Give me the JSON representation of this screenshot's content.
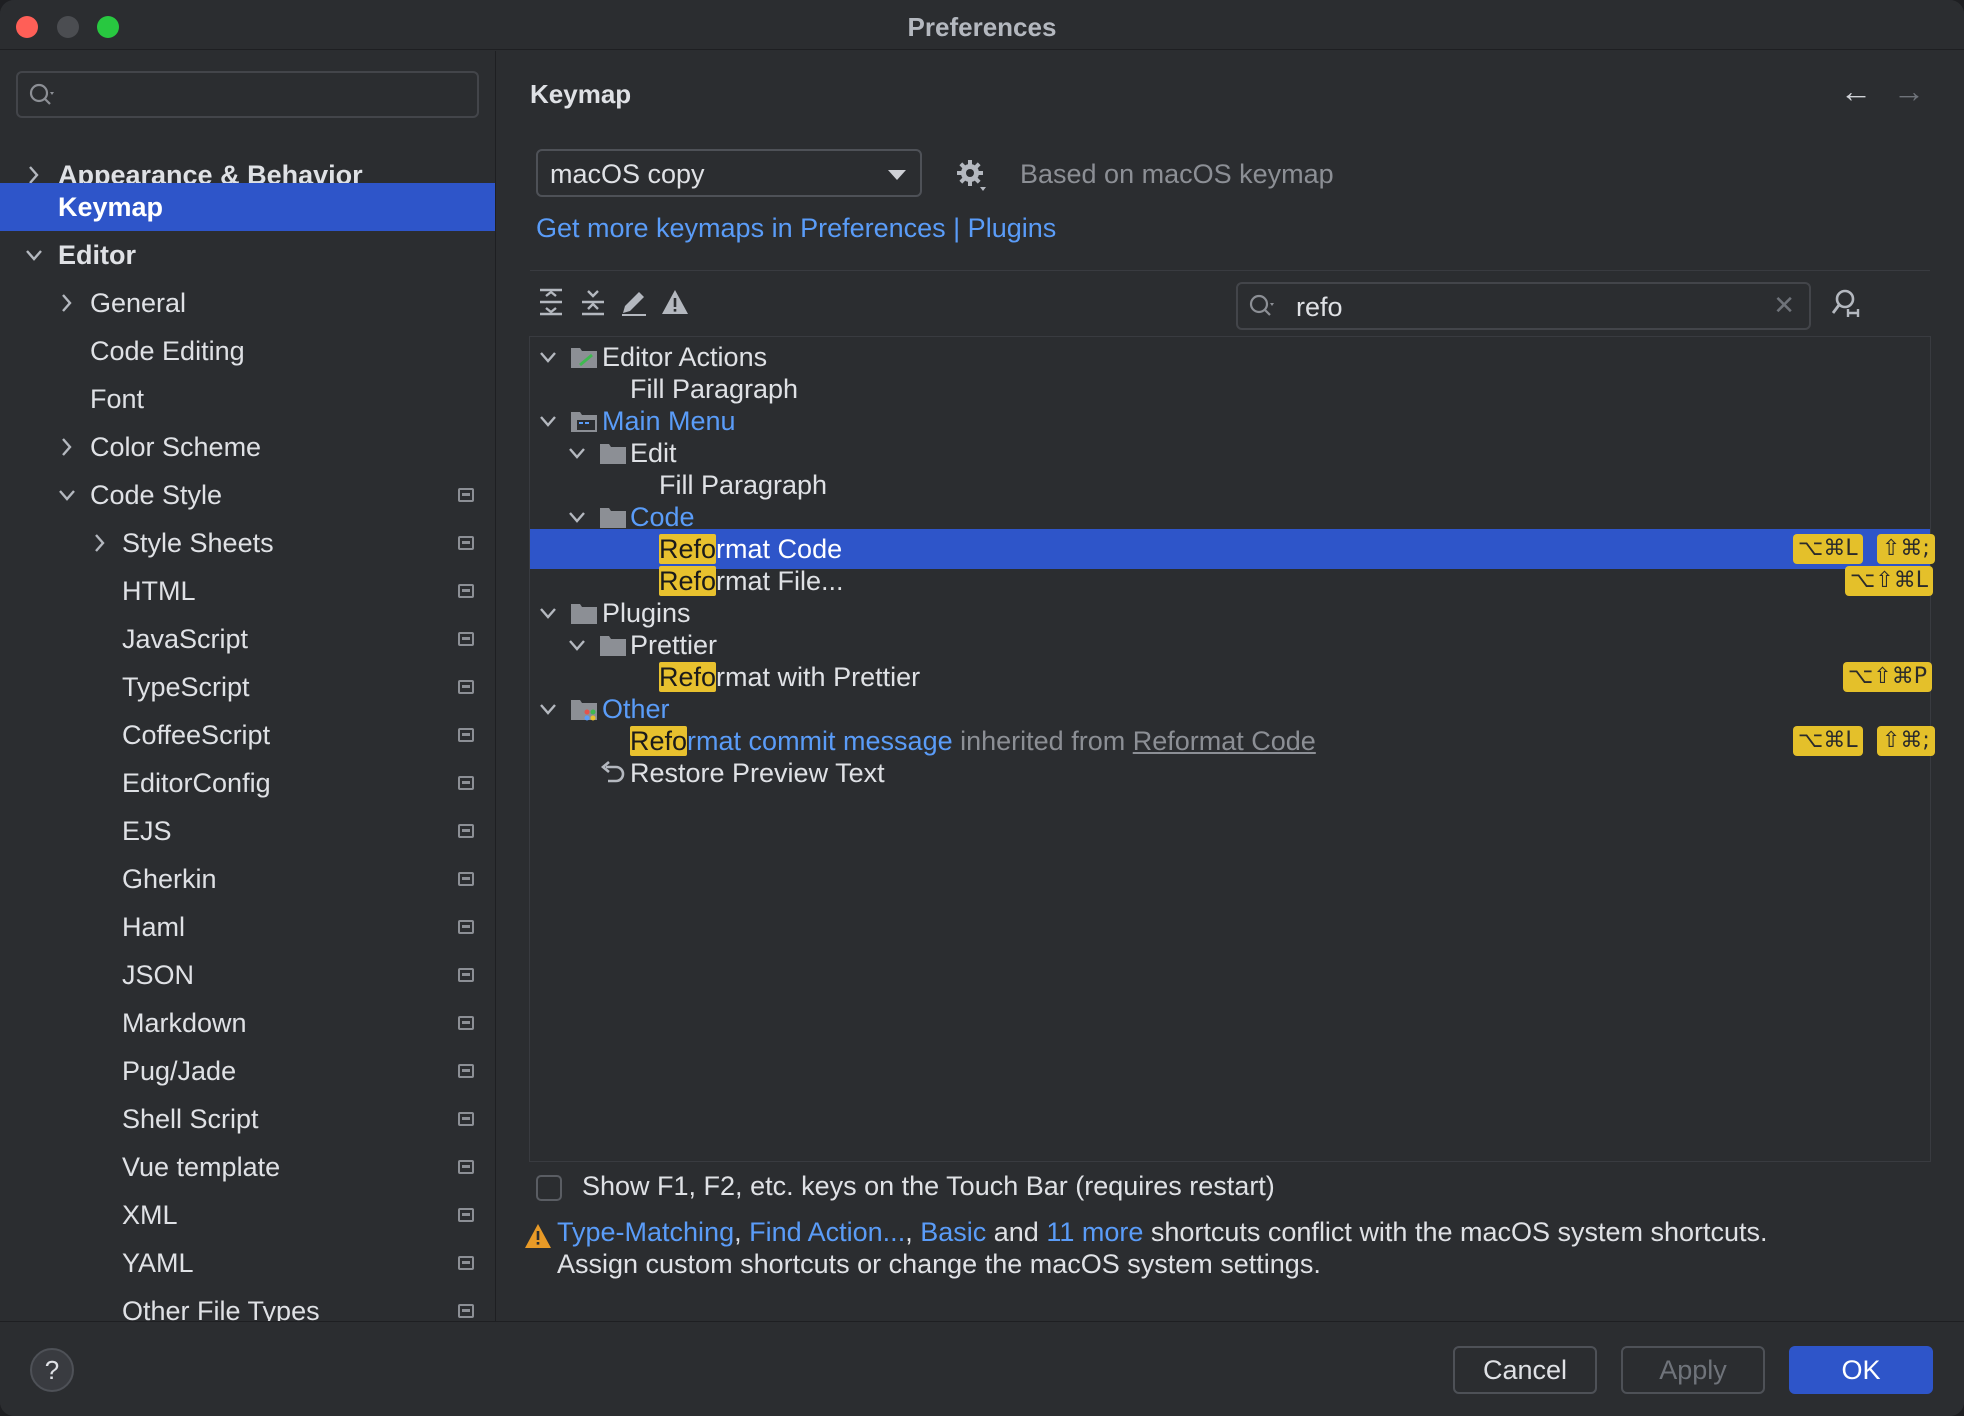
{
  "window": {
    "title": "Preferences"
  },
  "sidebar": {
    "search_placeholder": "",
    "items": [
      {
        "label": "Appearance & Behavior"
      },
      {
        "label": "Keymap"
      },
      {
        "label": "Editor"
      },
      {
        "label": "General"
      },
      {
        "label": "Code Editing"
      },
      {
        "label": "Font"
      },
      {
        "label": "Color Scheme"
      },
      {
        "label": "Code Style"
      },
      {
        "label": "Style Sheets"
      },
      {
        "label": "HTML"
      },
      {
        "label": "JavaScript"
      },
      {
        "label": "TypeScript"
      },
      {
        "label": "CoffeeScript"
      },
      {
        "label": "EditorConfig"
      },
      {
        "label": "EJS"
      },
      {
        "label": "Gherkin"
      },
      {
        "label": "Haml"
      },
      {
        "label": "JSON"
      },
      {
        "label": "Markdown"
      },
      {
        "label": "Pug/Jade"
      },
      {
        "label": "Shell Script"
      },
      {
        "label": "Vue template"
      },
      {
        "label": "XML"
      },
      {
        "label": "YAML"
      },
      {
        "label": "Other File Types"
      }
    ]
  },
  "main": {
    "title": "Keymap",
    "keymap_select": "macOS copy",
    "based_on": "Based on macOS keymap",
    "more_link": "Get more keymaps in Preferences | Plugins",
    "search_value": "refo",
    "tree": {
      "editor_actions": "Editor Actions",
      "fill_paragraph_1": "Fill Paragraph",
      "main_menu": "Main Menu",
      "edit": "Edit",
      "fill_paragraph_2": "Fill Paragraph",
      "code": "Code",
      "reformat_code": {
        "match": "Refo",
        "rest": "rmat Code",
        "keys": [
          "⌥⌘L",
          "⇧⌘;"
        ]
      },
      "reformat_file": {
        "match": "Refo",
        "rest": "rmat File...",
        "keys": [
          "⌥⇧⌘L"
        ]
      },
      "plugins": "Plugins",
      "prettier": "Prettier",
      "reformat_prettier": {
        "match": "Refo",
        "rest": "rmat with Prettier",
        "keys": [
          "⌥⇧⌘P"
        ]
      },
      "other": "Other",
      "reformat_commit": {
        "match": "Refo",
        "rest": "rmat commit message",
        "inherited": "inherited from",
        "source": "Reformat Code",
        "keys": [
          "⌥⌘L",
          "⇧⌘;"
        ]
      },
      "restore_preview": "Restore Preview Text"
    },
    "touchbar_label": "Show F1, F2, etc. keys on the Touch Bar (requires restart)",
    "warning": {
      "link1": "Type-Matching",
      "sep1": ", ",
      "link2": "Find Action...",
      "sep2": ", ",
      "link3": "Basic",
      "and": " and ",
      "link4": "11 more",
      "rest": " shortcuts conflict with the macOS system shortcuts.",
      "line2": "Assign custom shortcuts or change the macOS system settings."
    }
  },
  "footer": {
    "help": "?",
    "cancel": "Cancel",
    "apply": "Apply",
    "ok": "OK"
  },
  "colors": {
    "accent": "#2e55c9",
    "link": "#5a9cf8",
    "highlight": "#e8c12e",
    "background": "#2b2d30"
  }
}
